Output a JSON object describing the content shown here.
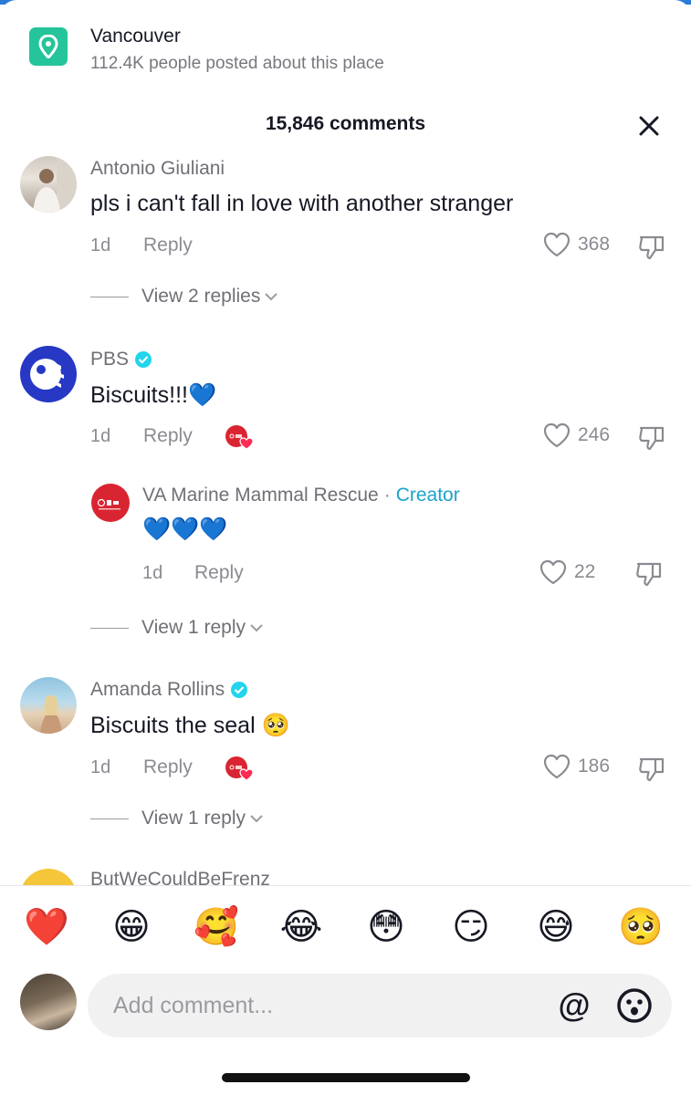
{
  "location": {
    "title": "Vancouver",
    "subtitle": "112.4K people posted about this place"
  },
  "header": {
    "comment_count": "15,846 comments"
  },
  "comments": [
    {
      "username": "Antonio Giuliani",
      "verified": false,
      "text": "pls i can't fall in love with another stranger",
      "age": "1d",
      "reply_label": "Reply",
      "likes": "368",
      "view_replies": "View 2 replies"
    },
    {
      "username": "PBS",
      "verified": true,
      "text": "Biscuits!!!💙",
      "age": "1d",
      "reply_label": "Reply",
      "likes": "246",
      "creator_liked": true,
      "reply": {
        "username": "VA Marine Mammal Rescue",
        "separator": "·",
        "tag": "Creator",
        "text": "💙💙💙",
        "age": "1d",
        "reply_label": "Reply",
        "likes": "22"
      },
      "view_replies": "View 1 reply"
    },
    {
      "username": "Amanda Rollins",
      "verified": true,
      "text": "Biscuits the seal 🥺",
      "age": "1d",
      "reply_label": "Reply",
      "likes": "186",
      "creator_liked": true,
      "view_replies": "View 1 reply"
    },
    {
      "username": "ButWeCouldBeFrenz",
      "partial": true
    }
  ],
  "emoji_bar": [
    "❤️",
    "😁",
    "🥰",
    "😂",
    "😳",
    "😏",
    "😅",
    "🥺"
  ],
  "composer": {
    "placeholder": "Add comment...",
    "at_label": "@"
  },
  "colors": {
    "location_icon": "#25c49a",
    "creator_tag": "#1aa3c9",
    "verified": "#20d5ec",
    "pbs_blue": "#2638c4"
  }
}
